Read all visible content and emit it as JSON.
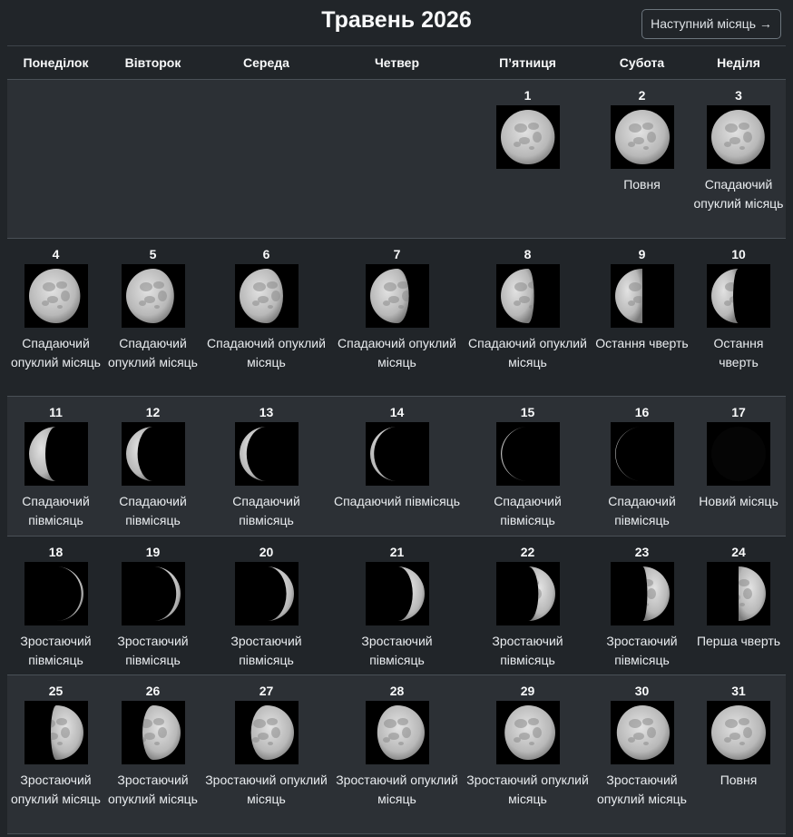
{
  "title": "Травень 2026",
  "next_button": "Наступний місяць →",
  "weekdays": [
    "Понеділок",
    "Вівторок",
    "Середа",
    "Четвер",
    "П’ятниця",
    "Субота",
    "Неділя"
  ],
  "colors": {
    "background": "#212529",
    "row_alt": "#2c3035",
    "moon_light": "#c9c9c9",
    "moon_dark": "#000000"
  },
  "weeks": [
    [
      null,
      null,
      null,
      null,
      {
        "day": "1",
        "phase": "",
        "illum": 0.99,
        "waxing": false
      },
      {
        "day": "2",
        "phase": "Повня",
        "illum": 1.0,
        "waxing": false
      },
      {
        "day": "3",
        "phase": "Спадаючий опуклий місяць",
        "illum": 0.98,
        "waxing": false
      }
    ],
    [
      {
        "day": "4",
        "phase": "Спадаючий опуклий місяць",
        "illum": 0.94,
        "waxing": false
      },
      {
        "day": "5",
        "phase": "Спадаючий опуклий місяць",
        "illum": 0.88,
        "waxing": false
      },
      {
        "day": "6",
        "phase": "Спадаючий опуклий місяць",
        "illum": 0.8,
        "waxing": false
      },
      {
        "day": "7",
        "phase": "Спадаючий опуклий місяць",
        "illum": 0.71,
        "waxing": false
      },
      {
        "day": "8",
        "phase": "Спадаючий опуклий місяць",
        "illum": 0.61,
        "waxing": false
      },
      {
        "day": "9",
        "phase": "Остання чверть",
        "illum": 0.5,
        "waxing": false
      },
      {
        "day": "10",
        "phase": "Остання чверть",
        "illum": 0.4,
        "waxing": false
      }
    ],
    [
      {
        "day": "11",
        "phase": "Спадаючий півмісяць",
        "illum": 0.3,
        "waxing": false
      },
      {
        "day": "12",
        "phase": "Спадаючий півмісяць",
        "illum": 0.21,
        "waxing": false
      },
      {
        "day": "13",
        "phase": "Спадаючий півмісяць",
        "illum": 0.13,
        "waxing": false
      },
      {
        "day": "14",
        "phase": "Спадаючий півмісяць",
        "illum": 0.07,
        "waxing": false
      },
      {
        "day": "15",
        "phase": "Спадаючий півмісяць",
        "illum": 0.02,
        "waxing": false
      },
      {
        "day": "16",
        "phase": "Спадаючий півмісяць",
        "illum": 0.01,
        "waxing": false
      },
      {
        "day": "17",
        "phase": "Новий місяць",
        "illum": 0.0,
        "waxing": true
      }
    ],
    [
      {
        "day": "18",
        "phase": "Зростаючий півмісяць",
        "illum": 0.04,
        "waxing": true
      },
      {
        "day": "19",
        "phase": "Зростаючий півмісяць",
        "illum": 0.08,
        "waxing": true
      },
      {
        "day": "20",
        "phase": "Зростаючий півмісяць",
        "illum": 0.14,
        "waxing": true
      },
      {
        "day": "21",
        "phase": "Зростаючий півмісяць",
        "illum": 0.22,
        "waxing": true
      },
      {
        "day": "22",
        "phase": "Зростаючий півмісяць",
        "illum": 0.31,
        "waxing": true
      },
      {
        "day": "23",
        "phase": "Зростаючий півмісяць",
        "illum": 0.41,
        "waxing": true
      },
      {
        "day": "24",
        "phase": "Перша чверть",
        "illum": 0.5,
        "waxing": true
      }
    ],
    [
      {
        "day": "25",
        "phase": "Зростаючий опуклий місяць",
        "illum": 0.6,
        "waxing": true
      },
      {
        "day": "26",
        "phase": "Зростаючий опуклий місяць",
        "illum": 0.7,
        "waxing": true
      },
      {
        "day": "27",
        "phase": "Зростаючий опуклий місяць",
        "illum": 0.79,
        "waxing": true
      },
      {
        "day": "28",
        "phase": "Зростаючий опуклий місяць",
        "illum": 0.87,
        "waxing": true
      },
      {
        "day": "29",
        "phase": "Зростаючий опуклий місяць",
        "illum": 0.93,
        "waxing": true
      },
      {
        "day": "30",
        "phase": "Зростаючий опуклий місяць",
        "illum": 0.97,
        "waxing": true
      },
      {
        "day": "31",
        "phase": "Повня",
        "illum": 1.0,
        "waxing": true
      }
    ]
  ]
}
